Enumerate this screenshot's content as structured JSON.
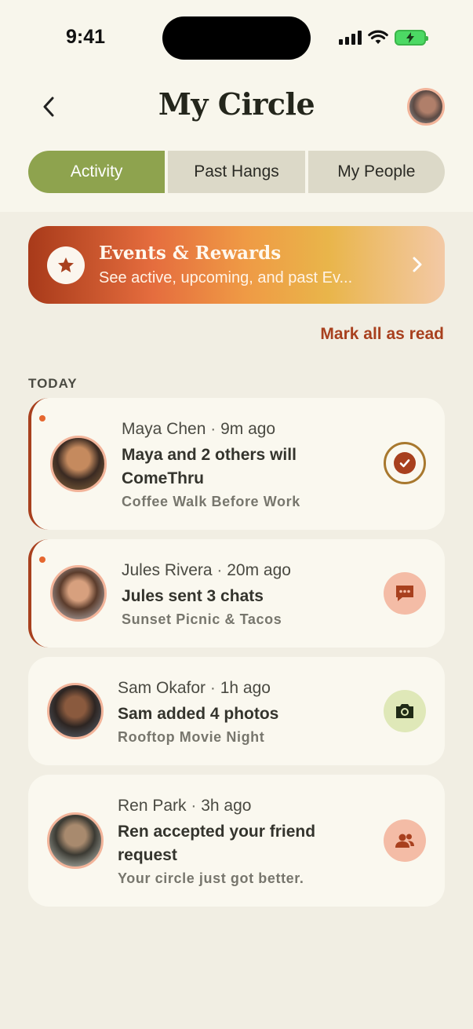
{
  "status_bar": {
    "time": "9:41"
  },
  "header": {
    "title": "My Circle",
    "back_icon": "chevron-left-icon",
    "profile_avatar": "profile-avatar"
  },
  "tabs": [
    {
      "label": "Activity",
      "active": true
    },
    {
      "label": "Past Hangs",
      "active": false
    },
    {
      "label": "My People",
      "active": false
    }
  ],
  "banner": {
    "title": "Events & Rewards",
    "subtitle": "See active, upcoming, and past Ev...",
    "icon": "star-icon"
  },
  "mark_all_read": "Mark all as read",
  "section_label": "TODAY",
  "notifications": [
    {
      "name": "Maya Chen",
      "time": "9m ago",
      "title": "Maya and 2 others will ComeThru",
      "subtitle": "Coffee Walk Before Work",
      "unread": true,
      "icon": "check-circle-icon"
    },
    {
      "name": "Jules Rivera",
      "time": "20m ago",
      "title": "Jules sent 3 chats",
      "subtitle": "Sunset Picnic & Tacos",
      "unread": true,
      "icon": "chat-icon"
    },
    {
      "name": "Sam Okafor",
      "time": "1h ago",
      "title": "Sam added 4 photos",
      "subtitle": "Rooftop Movie Night",
      "unread": false,
      "icon": "camera-icon"
    },
    {
      "name": "Ren Park",
      "time": "3h ago",
      "title": "Ren accepted your friend request",
      "subtitle": "Your circle just got better.",
      "unread": false,
      "icon": "people-icon"
    }
  ],
  "colors": {
    "accent_green": "#8ea34e",
    "accent_rust": "#a8401e",
    "background": "#f1eee3",
    "card": "#faf8ef"
  }
}
